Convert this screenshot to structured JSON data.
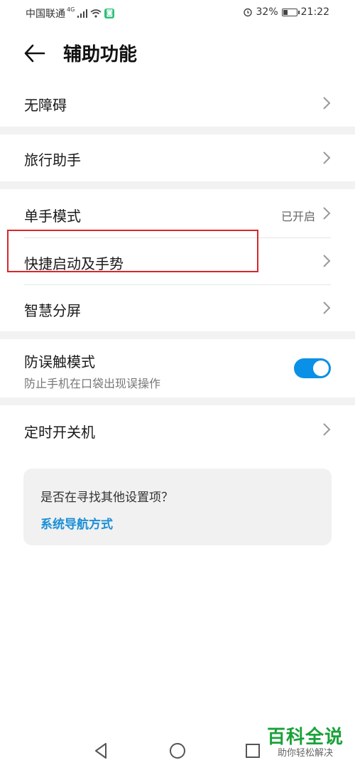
{
  "status_bar": {
    "carrier": "中国联通",
    "network": "4G",
    "battery": "32%",
    "battery_level": 0.32,
    "time": "21:22",
    "app_badge_icon": "app-notification-icon"
  },
  "header": {
    "title": "辅助功能",
    "back_icon": "back-arrow-icon"
  },
  "settings": {
    "accessibility": "无障碍",
    "travel_assistant": "旅行助手",
    "one_hand_mode": {
      "label": "单手模式",
      "value": "已开启"
    },
    "quick_launch": "快捷启动及手势",
    "smart_split": "智慧分屏",
    "anti_mistouch": {
      "label": "防误触模式",
      "subtitle": "防止手机在口袋出现误操作",
      "enabled": true
    },
    "scheduled_power": "定时开关机"
  },
  "suggestion_card": {
    "text": "是否在寻找其他设置项？",
    "link": "系统导航方式"
  },
  "nav_bar": {
    "back_icon": "nav-back-icon",
    "home_icon": "nav-home-icon",
    "recents_icon": "nav-recents-icon"
  },
  "watermark": {
    "title": "百科全说",
    "subtitle": "助你轻松解决"
  },
  "colors": {
    "accent": "#0a90e6",
    "link": "#1a8fd6",
    "highlight_border": "#d9262c",
    "section_gap": "#f2f2f2"
  }
}
